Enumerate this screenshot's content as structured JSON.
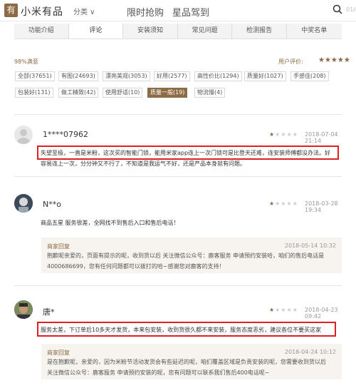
{
  "header": {
    "logo_char": "有",
    "brand": "小米有品",
    "category": "分类 ∨",
    "nav": [
      "限时抢购",
      "星品驾到"
    ],
    "search_hint": "01/8"
  },
  "tabs": [
    "功能介绍",
    "评论",
    "安装须知",
    "常见问题",
    "检测报告",
    "中奖名单"
  ],
  "summary": {
    "satisfaction": "98%满意",
    "rating_label": "用户评价:",
    "stars": "★★★★★"
  },
  "filters": [
    "全部(37651)",
    "有图(24693)",
    "漂亮美观(3053)",
    "好用(2577)",
    "高性价比(1294)",
    "质量好(1027)",
    "手感佳(208)",
    "包装好(131)",
    "做工精致(42)",
    "使用舒适(10)",
    "质量一般(19)",
    "物流慢(4)"
  ],
  "reviews": [
    {
      "user": "1****07962",
      "stars": "★",
      "stars_empty": "★★★★",
      "date": "2018-07-04 21:14",
      "text_line1": "失望至极，一直是米粉，这次买的智能门锁，能用米家app连上一次门锁可是比登天还难，连安装师傅都没办法。好",
      "text_line2": "容易连上一次，分分钟又不行了，不知道是我运气不好，还是产品本身就有问题。"
    },
    {
      "user": "N**o",
      "stars": "★",
      "stars_empty": "★★★★",
      "date": "2018-03-28 19:34",
      "text_line1": "商品五星 服务很差，全网找不到售后入口和售后电话！",
      "reply_label": "商家回复",
      "reply_date": "2018-05-14 10:32",
      "reply_line1": "抱歉呢亲爱的，页面有提示的呢，收到货以后 关注微信公众号：鹿客服务 申请预约安装哈，咱们的售后电话是",
      "reply_line2": "4000686699，您有任何问题都可以拨打的哈~感谢您对鹿客的支持！"
    },
    {
      "user": "唐*",
      "stars": "★",
      "stars_empty": "★★★★",
      "date": "2018-04-23 09:42",
      "text_line1": "服务太差，下订单后10多天才发货，本来包安装，收到货很久都不来安装，服务态度恶劣，建议各位不要买这家",
      "reply_label": "商家回复",
      "reply_date": "2018-04-24 10:12",
      "reply_line1": "是在抱歉呢，亲爱的，因为米粉节活动发货会有些延迟的呢，咱们覆盖区域是负责安装的呢，您需要收到货以后",
      "reply_line2": "关注微信公众号：鹿客服务 申请预约安装的呢，您有问题可以联系我们售后400电话呢~"
    }
  ]
}
